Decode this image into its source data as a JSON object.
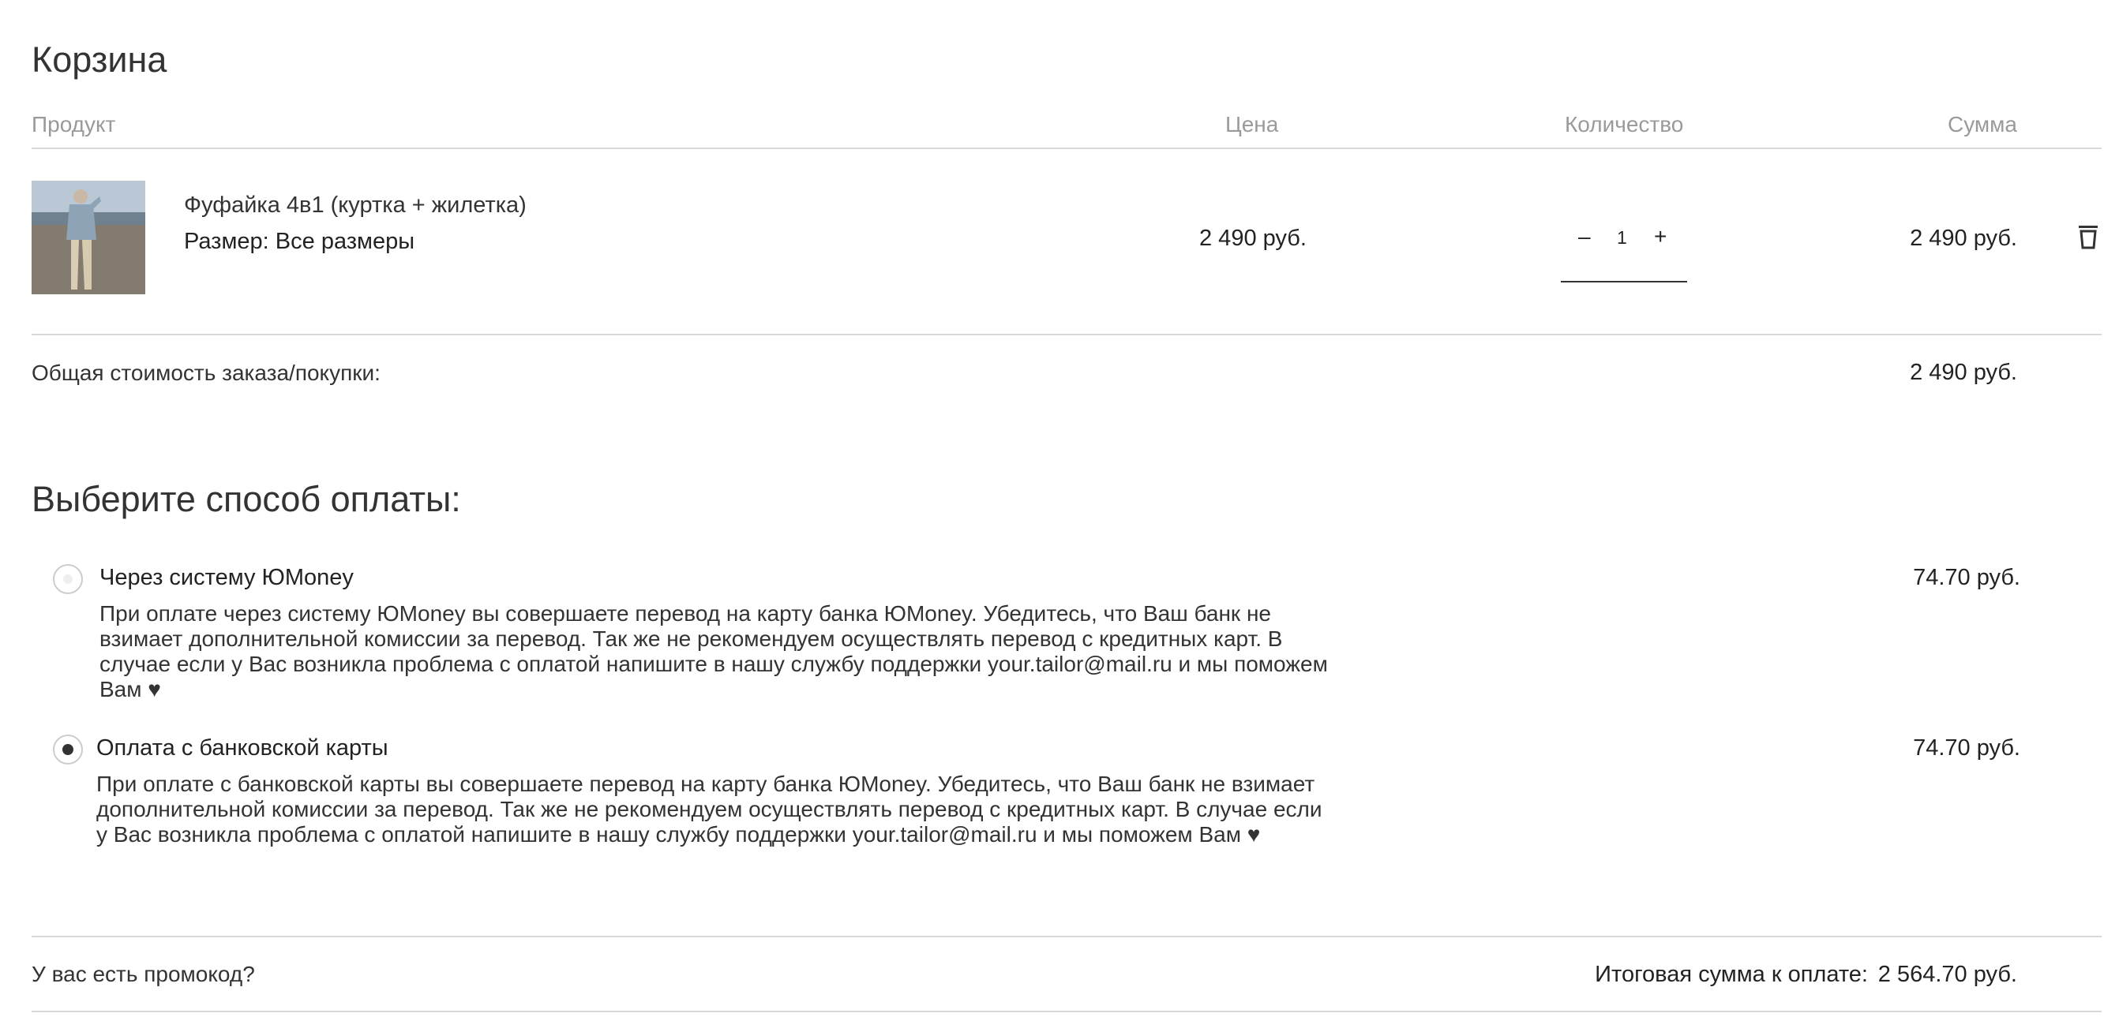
{
  "cart": {
    "title": "Корзина",
    "columns": {
      "product": "Продукт",
      "price": "Цена",
      "quantity": "Количество",
      "sum": "Сумма"
    },
    "items": [
      {
        "name": "Фуфайка 4в1 (куртка + жилетка)",
        "size": "Размер: Все размеры",
        "price": "2 490 руб.",
        "quantity": "1",
        "sum": "2 490 руб."
      }
    ],
    "qty_minus": "–",
    "qty_plus": "+",
    "total_label": "Общая стоимость заказа/покупки:",
    "total_value": "2 490 руб."
  },
  "payment": {
    "title": "Выберите способ оплаты:",
    "selected_index": 1,
    "options": [
      {
        "title": "Через систему ЮMoney",
        "description": "При оплате через систему ЮMoney вы совершаете перевод на карту банка ЮMoney. Убедитесь, что Ваш банк не взимает дополнительной комиссии за перевод. Так же не рекомендуем осуществлять перевод с кредитных карт. В случае если у Вас возникла проблема с оплатой напишите в нашу службу поддержки your.tailor@mail.ru и мы поможем Вам ♥",
        "fee": "74.70 руб."
      },
      {
        "title": "Оплата с банковской карты",
        "description": "При оплате с банковской карты вы совершаете перевод на карту банка ЮMoney. Убедитесь, что Ваш банк не взимает дополнительной комиссии за перевод. Так же не рекомендуем осуществлять перевод с кредитных карт. В случае если у Вас возникла проблема с оплатой напишите в нашу службу поддержки your.tailor@mail.ru и мы поможем Вам ♥",
        "fee": "74.70 руб."
      }
    ]
  },
  "footer": {
    "promo_label": "У вас есть промокод?",
    "final_label": "Итоговая сумма к оплате:",
    "final_value": "2 564.70 руб."
  },
  "colors": {
    "text": "#222222",
    "muted": "#9a9a9a",
    "divider": "#d8d8d8",
    "radio_dot": "#333333"
  },
  "icons": {
    "delete": "trash-icon",
    "product_image": "product-thumbnail"
  }
}
